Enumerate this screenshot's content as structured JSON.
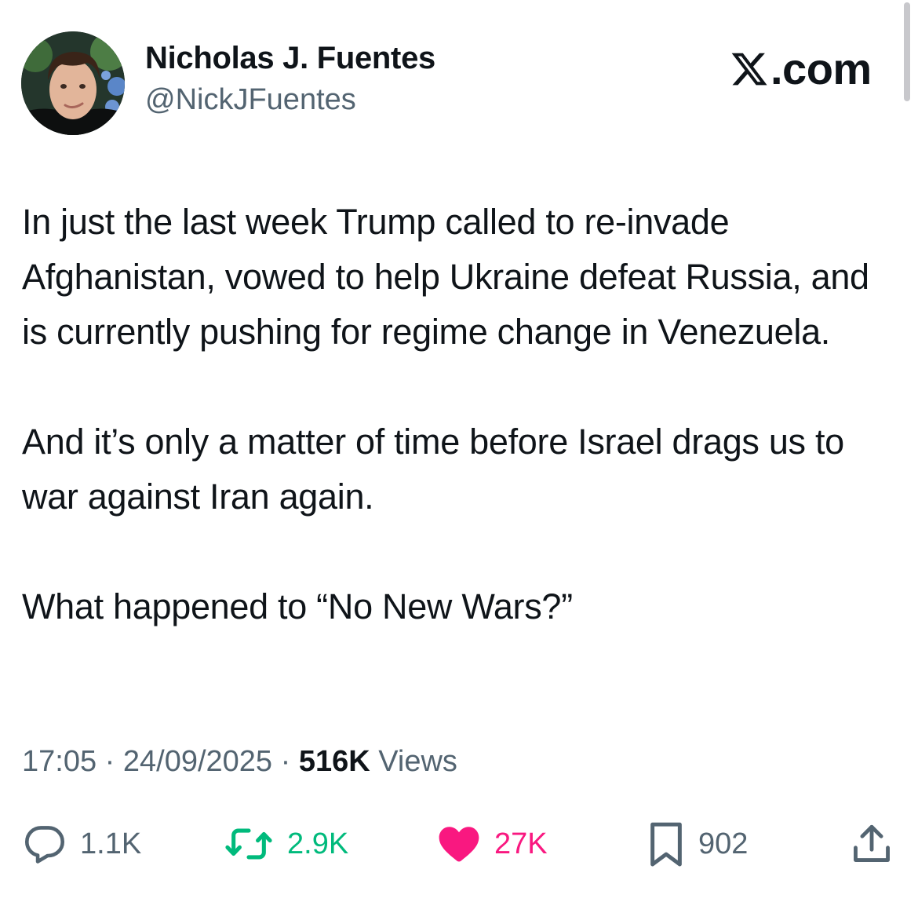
{
  "author": {
    "display_name": "Nicholas J. Fuentes",
    "handle": "@NickJFuentes"
  },
  "site": {
    "label": ".com",
    "logo_icon": "x-logo-icon"
  },
  "tweet": {
    "paragraphs": [
      "In just the last week Trump called to re-invade Afghanistan, vowed to help Ukraine defeat Russia, and is currently pushing for regime change in Venezuela.",
      "And it’s only a matter of time before Israel drags us to war against Iran again.",
      "What happened to “No New Wars?”"
    ]
  },
  "meta": {
    "time": "17:05",
    "separator": "·",
    "date": "24/09/2025",
    "views_count": "516K",
    "views_label": "Views"
  },
  "actions": {
    "replies": {
      "icon": "reply-bubble-icon",
      "count": "1.1K"
    },
    "reposts": {
      "icon": "repost-icon",
      "count": "2.9K"
    },
    "likes": {
      "icon": "heart-icon",
      "count": "27K"
    },
    "bookmarks": {
      "icon": "bookmark-icon",
      "count": "902"
    },
    "share": {
      "icon": "share-icon"
    }
  },
  "colors": {
    "text_primary": "#0f1419",
    "text_secondary": "#536471",
    "repost_green": "#00ba7c",
    "like_pink": "#f91880"
  }
}
